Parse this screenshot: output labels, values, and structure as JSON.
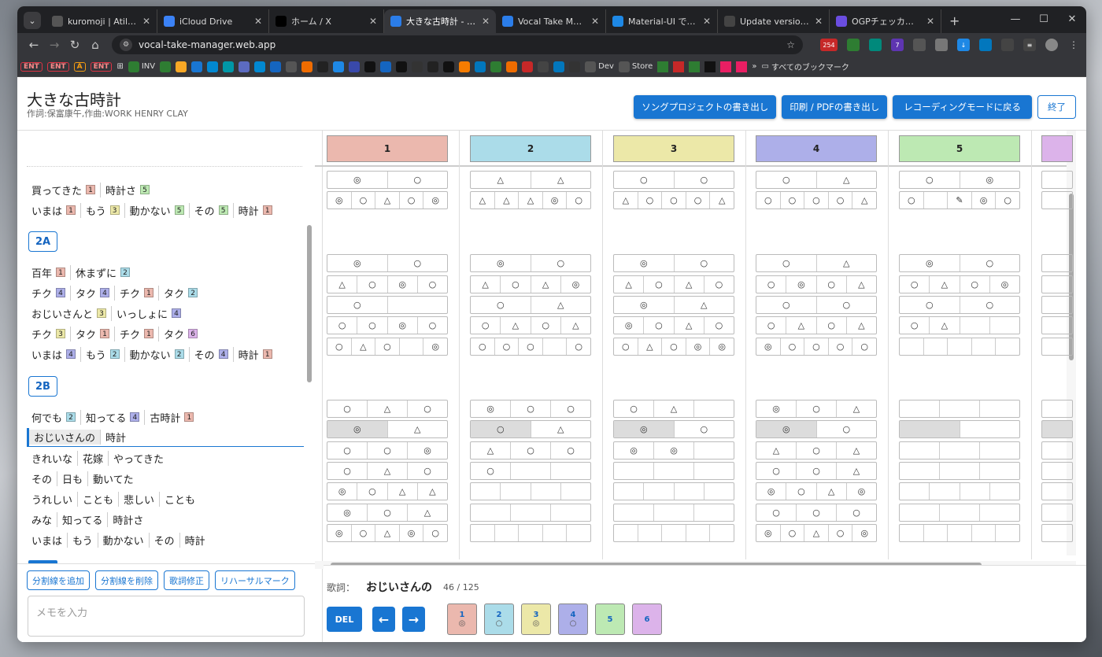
{
  "browser": {
    "tabs": [
      {
        "title": "kuromoji | Atilika",
        "color": "#555"
      },
      {
        "title": "iCloud Drive",
        "color": "#3b82f6"
      },
      {
        "title": "ホーム / X",
        "color": "#000"
      },
      {
        "title": "大きな古時計 - Voca",
        "color": "#2b7de9",
        "active": true
      },
      {
        "title": "Vocal Take Manage",
        "color": "#2b7de9"
      },
      {
        "title": "Material-UI でモバイ",
        "color": "#1e88e5"
      },
      {
        "title": "Update version to",
        "color": "#444"
      },
      {
        "title": "OGPチェッカー - X-Fa",
        "color": "#6a4de0"
      }
    ],
    "url": "vocal-take-manager.web.app",
    "bookmarks": [
      "ENT",
      "ENT",
      "A",
      "ENT",
      "INV",
      "Dev",
      "Store",
      "»",
      "すべてのブックマーク"
    ]
  },
  "app": {
    "title": "大きな古時計",
    "subtitle": "作詞:保富康午,作曲:WORK HENRY CLAY",
    "buttons": {
      "export_song": "ソングプロジェクトの書き出し",
      "export_pdf": "印刷 / PDFの書き出し",
      "back_recording": "レコーディングモードに戻る",
      "finish": "終了"
    }
  },
  "lyrics": {
    "sections": [
      "2A",
      "2B"
    ],
    "rows": [
      [
        [
          "買ってきた",
          "1"
        ],
        [
          "時計さ",
          "5"
        ]
      ],
      [
        [
          "いまは",
          "1"
        ],
        [
          "もう",
          "3"
        ],
        [
          "動かない",
          "5"
        ],
        [
          "その",
          "5"
        ],
        [
          "時計",
          "1"
        ]
      ],
      [
        [
          "百年",
          "1"
        ],
        [
          "休まずに",
          "2"
        ]
      ],
      [
        [
          "チク",
          "4"
        ],
        [
          "タク",
          "4"
        ],
        [
          "チク",
          "1"
        ],
        [
          "タク",
          "2"
        ]
      ],
      [
        [
          "おじいさんと",
          "3"
        ],
        [
          "いっしょに",
          "4"
        ]
      ],
      [
        [
          "チク",
          "3"
        ],
        [
          "タク",
          "1"
        ],
        [
          "チク",
          "1"
        ],
        [
          "タク",
          "6"
        ]
      ],
      [
        [
          "いまは",
          "4"
        ],
        [
          "もう",
          "2"
        ],
        [
          "動かない",
          "2"
        ],
        [
          "その",
          "4"
        ],
        [
          "時計",
          "1"
        ]
      ],
      [
        [
          "何でも",
          "2"
        ],
        [
          "知ってる",
          "4"
        ],
        [
          "古時計",
          "1"
        ]
      ],
      [
        [
          "おじいさんの",
          ""
        ],
        [
          "時計",
          ""
        ]
      ],
      [
        [
          "きれいな",
          ""
        ],
        [
          "花嫁",
          ""
        ],
        [
          "やってきた",
          ""
        ]
      ],
      [
        [
          "その",
          ""
        ],
        [
          "日も",
          ""
        ],
        [
          "動いてた",
          ""
        ]
      ],
      [
        [
          "うれしい",
          ""
        ],
        [
          "ことも",
          ""
        ],
        [
          "悲しい",
          ""
        ],
        [
          "ことも",
          ""
        ]
      ],
      [
        [
          "みな",
          ""
        ],
        [
          "知ってる",
          ""
        ],
        [
          "時計さ",
          ""
        ]
      ],
      [
        [
          "いまは",
          ""
        ],
        [
          "もう",
          ""
        ],
        [
          "動かない",
          ""
        ],
        [
          "その",
          ""
        ],
        [
          "時計",
          ""
        ]
      ]
    ]
  },
  "left_actions": {
    "add_divider": "分割線を追加",
    "remove_divider": "分割線を削除",
    "fix_lyrics": "歌詞修正",
    "rehearsal_mark": "リハーサルマーク",
    "memo_placeholder": "メモを入力"
  },
  "takes": {
    "headers": [
      "1",
      "2",
      "3",
      "4",
      "5"
    ],
    "colors": [
      "#ebb8ae",
      "#abdce9",
      "#ece8a8",
      "#adafe9",
      "#bde9b3",
      "#dcb3ea"
    ],
    "grid": [
      [
        [
          "◎",
          "○"
        ],
        [
          "△",
          "△"
        ],
        [
          "○",
          "○"
        ],
        [
          "○",
          "△"
        ],
        [
          "○",
          "◎"
        ]
      ],
      [
        [
          "◎",
          "○",
          "△",
          "○",
          "◎"
        ],
        [
          "△",
          "△",
          "△",
          "◎",
          "○"
        ],
        [
          "△",
          "○",
          "○",
          "○",
          "△"
        ],
        [
          "○",
          "○",
          "○",
          "○",
          "△"
        ],
        [
          "○",
          "",
          "✎",
          "◎",
          "○"
        ]
      ],
      [
        [
          "◎",
          "○"
        ],
        [
          "◎",
          "○"
        ],
        [
          "◎",
          "○"
        ],
        [
          "○",
          "△"
        ],
        [
          "◎",
          "○"
        ]
      ],
      [
        [
          "△",
          "○",
          "◎",
          "○"
        ],
        [
          "△",
          "○",
          "△",
          "◎"
        ],
        [
          "△",
          "○",
          "△",
          "○"
        ],
        [
          "○",
          "◎",
          "○",
          "△"
        ],
        [
          "○",
          "△",
          "○",
          "◎"
        ]
      ],
      [
        [
          "○",
          ""
        ],
        [
          "○",
          "△"
        ],
        [
          "◎",
          "△"
        ],
        [
          "○",
          "○"
        ],
        [
          "○",
          "○"
        ]
      ],
      [
        [
          "○",
          "○",
          "◎",
          "○"
        ],
        [
          "○",
          "△",
          "○",
          "△"
        ],
        [
          "◎",
          "○",
          "△",
          "○"
        ],
        [
          "○",
          "△",
          "○",
          "△"
        ],
        [
          "○",
          "△",
          "",
          ""
        ]
      ],
      [
        [
          "○",
          "△",
          "○",
          "",
          "◎"
        ],
        [
          "○",
          "○",
          "○",
          "",
          "○"
        ],
        [
          "○",
          "△",
          "○",
          "◎",
          "◎"
        ],
        [
          "◎",
          "○",
          "○",
          "○",
          "○"
        ],
        [
          "",
          "",
          "",
          "",
          ""
        ]
      ],
      [
        [
          "○",
          "△",
          "○"
        ],
        [
          "◎",
          "○",
          "○"
        ],
        [
          "○",
          "△",
          ""
        ],
        [
          "◎",
          "○",
          "△"
        ],
        [
          "",
          "",
          ""
        ]
      ],
      [
        [
          "◎",
          "△"
        ],
        [
          "○",
          "△"
        ],
        [
          "◎",
          "○"
        ],
        [
          "◎",
          "○"
        ],
        [
          "",
          ""
        ]
      ],
      [
        [
          "○",
          "○",
          "◎"
        ],
        [
          "△",
          "○",
          "○"
        ],
        [
          "◎",
          "◎",
          ""
        ],
        [
          "△",
          "○",
          "△"
        ],
        [
          "",
          "",
          ""
        ]
      ],
      [
        [
          "○",
          "△",
          "○"
        ],
        [
          "○",
          "",
          ""
        ],
        [
          "",
          "",
          ""
        ],
        [
          "○",
          "○",
          "△"
        ],
        [
          "",
          "",
          ""
        ]
      ],
      [
        [
          "◎",
          "○",
          "△",
          "△"
        ],
        [
          "",
          "",
          "",
          ""
        ],
        [
          "",
          "",
          "",
          ""
        ],
        [
          "◎",
          "○",
          "△",
          "◎"
        ],
        [
          "",
          "",
          "",
          ""
        ]
      ],
      [
        [
          "◎",
          "○",
          "△"
        ],
        [
          "",
          "",
          ""
        ],
        [
          "",
          "",
          ""
        ],
        [
          "○",
          "○",
          "○"
        ],
        [
          "",
          "",
          ""
        ]
      ],
      [
        [
          "◎",
          "○",
          "△",
          "◎",
          "○"
        ],
        [
          "",
          "",
          "",
          "",
          ""
        ],
        [
          "",
          "",
          "",
          "",
          ""
        ],
        [
          "◎",
          "○",
          "△",
          "○",
          "◎"
        ],
        [
          "",
          "",
          "",
          "",
          ""
        ]
      ]
    ]
  },
  "bottom": {
    "lyric_label": "歌詞：",
    "lyric_value": "おじいさんの",
    "counter": "46 / 125",
    "del": "DEL",
    "takes": [
      {
        "n": "1",
        "m": "◎"
      },
      {
        "n": "2",
        "m": "○"
      },
      {
        "n": "3",
        "m": "◎"
      },
      {
        "n": "4",
        "m": "○"
      },
      {
        "n": "5",
        "m": ""
      },
      {
        "n": "6",
        "m": ""
      }
    ]
  }
}
